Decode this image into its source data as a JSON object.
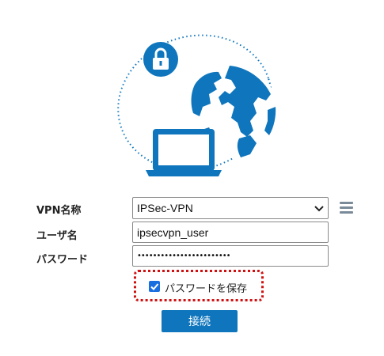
{
  "icons": {
    "lock": "lock-icon",
    "globe": "globe-icon",
    "laptop": "laptop-icon",
    "menu": "hamburger-menu-icon",
    "select_arrow": "chevron-down-icon",
    "checkmark": "checkmark-icon"
  },
  "colors": {
    "accent": "#0f76bd",
    "highlight_border": "#d01010",
    "checkbox": "#1a6fe0"
  },
  "form": {
    "vpn_name": {
      "label": "VPN名称",
      "selected": "IPSec-VPN"
    },
    "username": {
      "label": "ユーザ名",
      "value": "ipsecvpn_user"
    },
    "password": {
      "label": "パスワード",
      "masked_value": "••••••••••••••••••••••••"
    },
    "save_password": {
      "label": "パスワードを保存",
      "checked": true
    },
    "connect_button": "接続"
  }
}
